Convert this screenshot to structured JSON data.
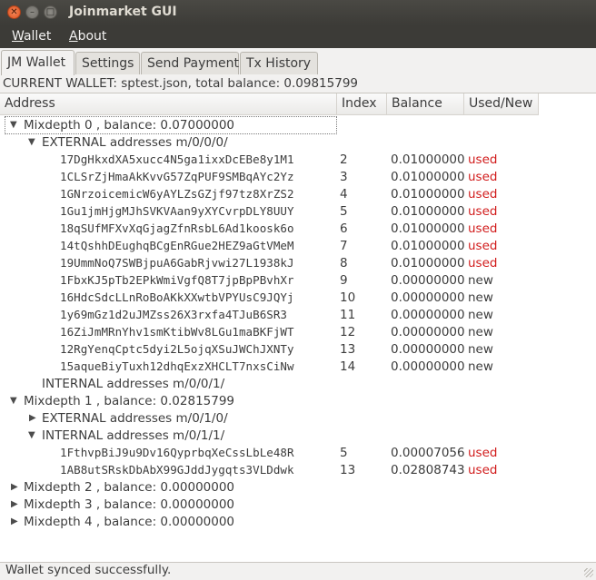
{
  "window": {
    "title": "Joinmarket GUI"
  },
  "menu": {
    "wallet": "Wallet",
    "wallet_mn": "W",
    "wallet_rest": "allet",
    "about_mn": "A",
    "about_rest": "bout"
  },
  "tabs": [
    "JM Wallet",
    "Settings",
    "Send Payment",
    "Tx History"
  ],
  "wallet_status": "CURRENT WALLET: sptest.json, total balance: 0.09815799",
  "columns": [
    "Address",
    "Index",
    "Balance",
    "Used/New"
  ],
  "colors": {
    "used": "#d11b1b"
  },
  "tree": {
    "md0": "Mixdepth 0 , balance: 0.07000000",
    "md0_ext": "EXTERNAL addresses m/0/0/0/",
    "md0_ext_rows": [
      {
        "addr": "17DgHkxdXA5xucc4N5ga1ixxDcEBe8y1M1",
        "index": "2",
        "balance": "0.01000000",
        "status": "used"
      },
      {
        "addr": "1CLSrZjHmaAkKvvG57ZqPUF9SMBqAYc2Yz",
        "index": "3",
        "balance": "0.01000000",
        "status": "used"
      },
      {
        "addr": "1GNrzoicemicW6yAYLZsGZjf97tz8XrZS2",
        "index": "4",
        "balance": "0.01000000",
        "status": "used"
      },
      {
        "addr": "1Gu1jmHjgMJhSVKVAan9yXYCvrpDLY8UUY",
        "index": "5",
        "balance": "0.01000000",
        "status": "used"
      },
      {
        "addr": "18qSUfMFXvXqGjagZfnRsbL6Ad1koosk6o",
        "index": "6",
        "balance": "0.01000000",
        "status": "used"
      },
      {
        "addr": "14tQshhDEughqBCgEnRGue2HEZ9aGtVMeM",
        "index": "7",
        "balance": "0.01000000",
        "status": "used"
      },
      {
        "addr": "19UmmNoQ7SWBjpuA6GabRjvwi27L1938kJ",
        "index": "8",
        "balance": "0.01000000",
        "status": "used"
      },
      {
        "addr": "1FbxKJ5pTb2EPkWmiVgfQ8T7jpBpPBvhXr",
        "index": "9",
        "balance": "0.00000000",
        "status": "new"
      },
      {
        "addr": "16HdcSdcLLnRoBoAKkXXwtbVPYUsC9JQYj",
        "index": "10",
        "balance": "0.00000000",
        "status": "new"
      },
      {
        "addr": "1y69mGz1d2uJMZss26X3rxfa4TJuB6SR3",
        "index": "11",
        "balance": "0.00000000",
        "status": "new"
      },
      {
        "addr": "16ZiJmMRnYhv1smKtibWv8LGu1maBKFjWT",
        "index": "12",
        "balance": "0.00000000",
        "status": "new"
      },
      {
        "addr": "12RgYenqCptc5dyi2L5ojqXSuJWChJXNTy",
        "index": "13",
        "balance": "0.00000000",
        "status": "new"
      },
      {
        "addr": "15aqueBiyTuxh12dhqExzXHCLT7nxsCiNw",
        "index": "14",
        "balance": "0.00000000",
        "status": "new"
      }
    ],
    "md0_int": "INTERNAL addresses m/0/0/1/",
    "md1": "Mixdepth 1 , balance: 0.02815799",
    "md1_ext": "EXTERNAL addresses m/0/1/0/",
    "md1_int": "INTERNAL addresses m/0/1/1/",
    "md1_int_rows": [
      {
        "addr": "1FthvpBiJ9u9Dv16QyprbqXeCssLbLe48R",
        "index": "5",
        "balance": "0.00007056",
        "status": "used"
      },
      {
        "addr": "1AB8utSRskDbAbX99GJddJygqts3VLDdwk",
        "index": "13",
        "balance": "0.02808743",
        "status": "used"
      }
    ],
    "md2": "Mixdepth 2 , balance: 0.00000000",
    "md3": "Mixdepth 3 , balance: 0.00000000",
    "md4": "Mixdepth 4 , balance: 0.00000000"
  },
  "status_bar": "Wallet synced successfully."
}
